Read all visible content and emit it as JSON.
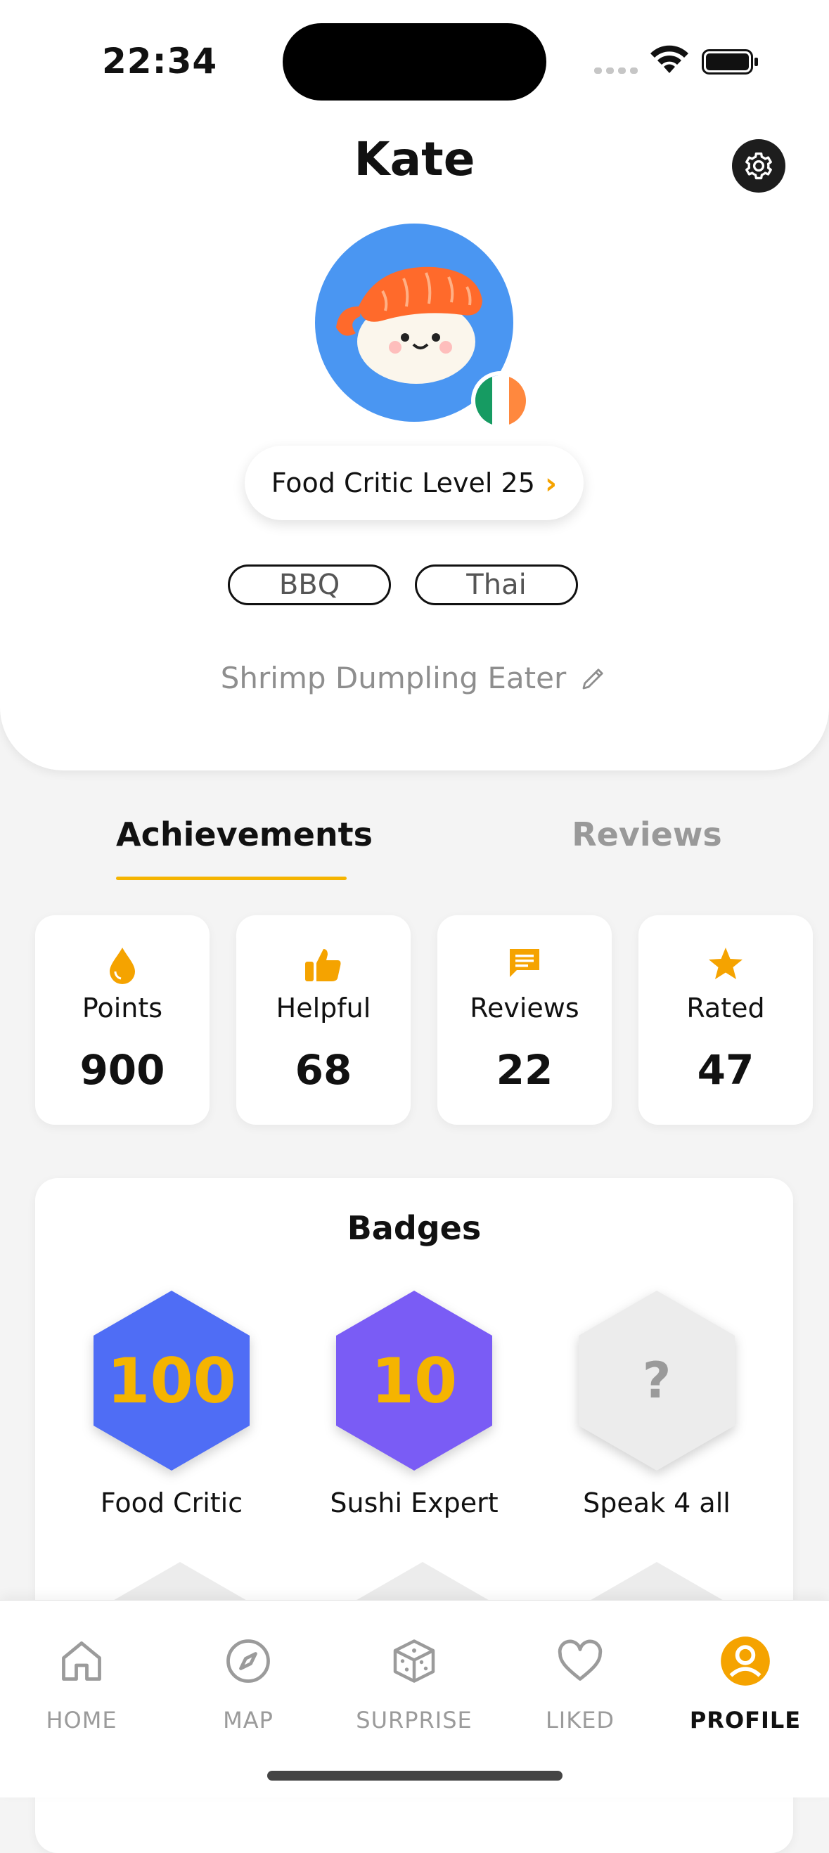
{
  "status_bar": {
    "time": "22:34"
  },
  "profile": {
    "name": "Kate",
    "level_label": "Food Critic Level 25",
    "tags": [
      "BBQ",
      "Thai"
    ],
    "bio": "Shrimp Dumpling Eater",
    "flag_colors": [
      "#169b62",
      "#ffffff",
      "#ff883e"
    ]
  },
  "tabs": [
    {
      "label": "Achievements",
      "active": true
    },
    {
      "label": "Reviews",
      "active": false
    }
  ],
  "stats": [
    {
      "label": "Points",
      "value": "900",
      "icon": "drop-icon"
    },
    {
      "label": "Helpful",
      "value": "68",
      "icon": "thumbs-up-icon"
    },
    {
      "label": "Reviews",
      "value": "22",
      "icon": "message-icon"
    },
    {
      "label": "Rated",
      "value": "47",
      "icon": "star-icon"
    }
  ],
  "badges": {
    "title": "Badges",
    "items": [
      {
        "value": "100",
        "label": "Food Critic",
        "color": "#4f6df5"
      },
      {
        "value": "10",
        "label": "Sushi Expert",
        "color": "#7a5cf5"
      },
      {
        "value": "?",
        "label": "Speak 4 all",
        "color": "#ececec"
      }
    ]
  },
  "nav": [
    {
      "label": "HOME",
      "icon": "home-icon",
      "active": false
    },
    {
      "label": "MAP",
      "icon": "compass-icon",
      "active": false
    },
    {
      "label": "SURPRISE",
      "icon": "dice-icon",
      "active": false
    },
    {
      "label": "LIKED",
      "icon": "heart-icon",
      "active": false
    },
    {
      "label": "PROFILE",
      "icon": "user-icon",
      "active": true
    }
  ],
  "colors": {
    "accent": "#f5a300",
    "avatar_bg": "#4a96f2"
  }
}
